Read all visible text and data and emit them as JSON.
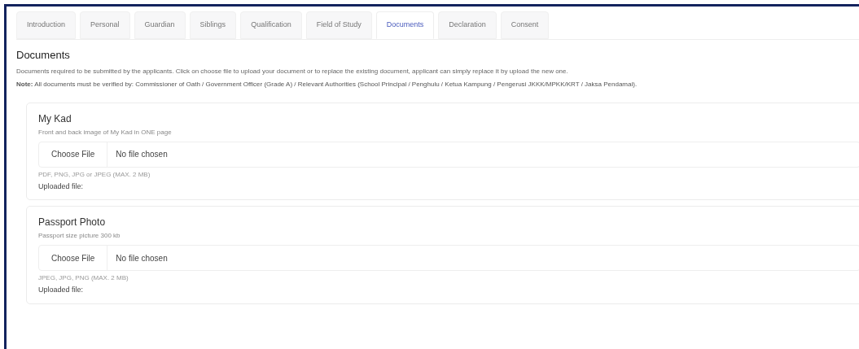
{
  "tabs": [
    {
      "label": "Introduction",
      "selected": false
    },
    {
      "label": "Personal",
      "selected": false
    },
    {
      "label": "Guardian",
      "selected": false
    },
    {
      "label": "Siblings",
      "selected": false
    },
    {
      "label": "Qualification",
      "selected": false
    },
    {
      "label": "Field of Study",
      "selected": false
    },
    {
      "label": "Documents",
      "selected": true
    },
    {
      "label": "Declaration",
      "selected": false
    },
    {
      "label": "Consent",
      "selected": false
    }
  ],
  "section": {
    "title": "Documents",
    "description": "Documents required to be submitted by the applicants. Click on choose file to upload your document or to replace the existing document, applicant can simply replace it by upload the new one.",
    "note": "**Note:** All documents must be verified by: Commissioner of Oath / Government Officer (Grade A) / Relevant Authorities (School Principal / Penghulu / Ketua Kampung / Pengerusi JKKK/MPKK/KRT / Jaksa Pendamai)."
  },
  "documents": [
    {
      "title": "My Kad",
      "hint": "Front and back image of My Kad in ONE page",
      "button": "Choose File",
      "status": "No file chosen",
      "formats": "PDF, PNG, JPG or JPEG (MAX. 2 MB)",
      "uploaded_label": "Uploaded file:"
    },
    {
      "title": "Passport Photo",
      "hint": "Passport size picture 300 kb",
      "button": "Choose File",
      "status": "No file chosen",
      "formats": "JPEG, JPG, PNG (MAX. 2 MB)",
      "uploaded_label": "Uploaded file:"
    }
  ]
}
